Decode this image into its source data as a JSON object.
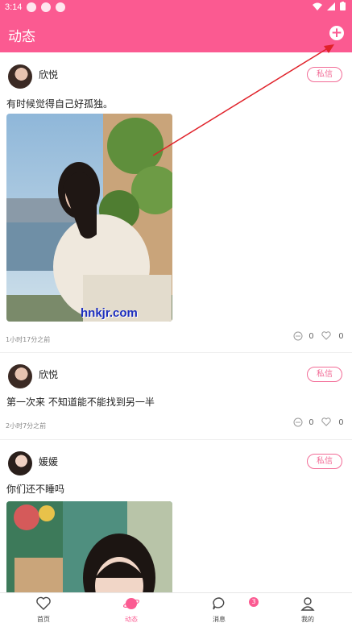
{
  "status_bar": {
    "time": "3:14"
  },
  "header": {
    "title": "动态"
  },
  "posts": [
    {
      "username": "欣悦",
      "message_button": "私信",
      "text": "有时候觉得自己好孤独。",
      "time": "1小时17分之前",
      "comments": "0",
      "likes": "0",
      "watermark": "hnkjr.com"
    },
    {
      "username": "欣悦",
      "message_button": "私信",
      "text": "第一次来 不知道能不能找到另一半",
      "time": "2小时7分之前",
      "comments": "0",
      "likes": "0"
    },
    {
      "username": "媛媛",
      "message_button": "私信",
      "text": "你们还不睡吗"
    }
  ],
  "tabs": [
    {
      "label": "首页"
    },
    {
      "label": "动态"
    },
    {
      "label": "消息",
      "badge": "3"
    },
    {
      "label": "我的"
    }
  ],
  "colors": {
    "accent": "#fb5a91",
    "arrow": "#e0222a"
  }
}
